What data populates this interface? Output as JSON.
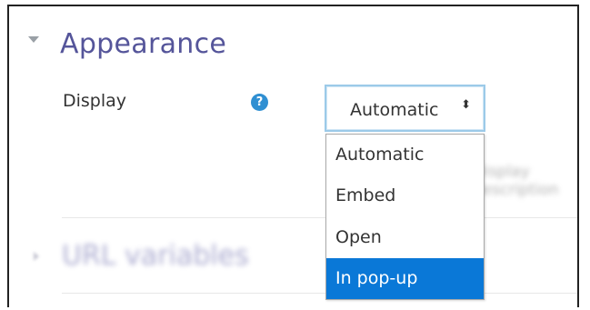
{
  "section": {
    "title": "Appearance",
    "next_section_title": "URL variables"
  },
  "field": {
    "label": "Display",
    "help_icon_glyph": "?",
    "select_value": "Automatic",
    "select_arrows": "⬍",
    "background_hint": "Display description"
  },
  "dropdown": {
    "options": [
      {
        "label": "Automatic"
      },
      {
        "label": "Embed"
      },
      {
        "label": "Open"
      },
      {
        "label": "In pop-up"
      }
    ],
    "highlighted": "In pop-up"
  },
  "colors": {
    "section_title": "#55559a",
    "help_icon": "#2f8fd2",
    "select_focus_border": "#9ccae8",
    "highlight": "#0a78d7"
  }
}
